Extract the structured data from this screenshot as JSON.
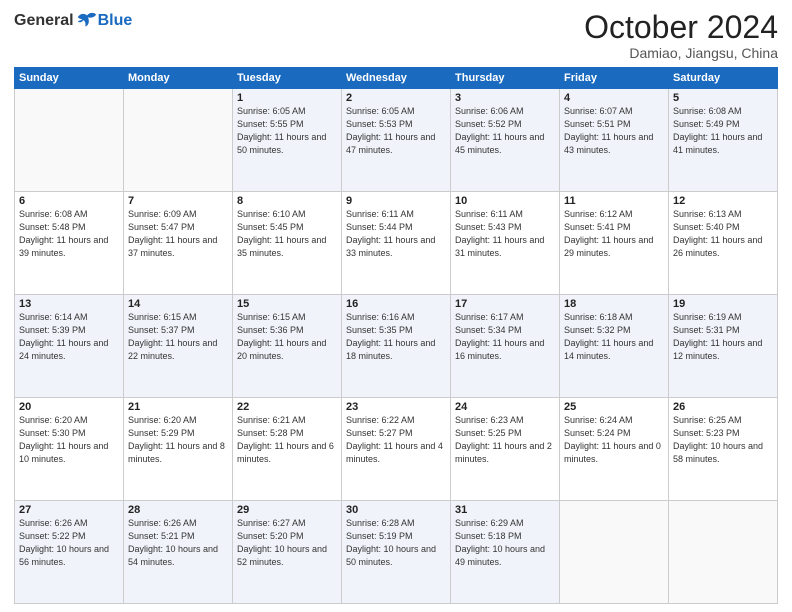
{
  "header": {
    "logo_general": "General",
    "logo_blue": "Blue",
    "month": "October 2024",
    "location": "Damiao, Jiangsu, China"
  },
  "weekdays": [
    "Sunday",
    "Monday",
    "Tuesday",
    "Wednesday",
    "Thursday",
    "Friday",
    "Saturday"
  ],
  "weeks": [
    [
      {
        "day": "",
        "info": ""
      },
      {
        "day": "",
        "info": ""
      },
      {
        "day": "1",
        "info": "Sunrise: 6:05 AM\nSunset: 5:55 PM\nDaylight: 11 hours and 50 minutes."
      },
      {
        "day": "2",
        "info": "Sunrise: 6:05 AM\nSunset: 5:53 PM\nDaylight: 11 hours and 47 minutes."
      },
      {
        "day": "3",
        "info": "Sunrise: 6:06 AM\nSunset: 5:52 PM\nDaylight: 11 hours and 45 minutes."
      },
      {
        "day": "4",
        "info": "Sunrise: 6:07 AM\nSunset: 5:51 PM\nDaylight: 11 hours and 43 minutes."
      },
      {
        "day": "5",
        "info": "Sunrise: 6:08 AM\nSunset: 5:49 PM\nDaylight: 11 hours and 41 minutes."
      }
    ],
    [
      {
        "day": "6",
        "info": "Sunrise: 6:08 AM\nSunset: 5:48 PM\nDaylight: 11 hours and 39 minutes."
      },
      {
        "day": "7",
        "info": "Sunrise: 6:09 AM\nSunset: 5:47 PM\nDaylight: 11 hours and 37 minutes."
      },
      {
        "day": "8",
        "info": "Sunrise: 6:10 AM\nSunset: 5:45 PM\nDaylight: 11 hours and 35 minutes."
      },
      {
        "day": "9",
        "info": "Sunrise: 6:11 AM\nSunset: 5:44 PM\nDaylight: 11 hours and 33 minutes."
      },
      {
        "day": "10",
        "info": "Sunrise: 6:11 AM\nSunset: 5:43 PM\nDaylight: 11 hours and 31 minutes."
      },
      {
        "day": "11",
        "info": "Sunrise: 6:12 AM\nSunset: 5:41 PM\nDaylight: 11 hours and 29 minutes."
      },
      {
        "day": "12",
        "info": "Sunrise: 6:13 AM\nSunset: 5:40 PM\nDaylight: 11 hours and 26 minutes."
      }
    ],
    [
      {
        "day": "13",
        "info": "Sunrise: 6:14 AM\nSunset: 5:39 PM\nDaylight: 11 hours and 24 minutes."
      },
      {
        "day": "14",
        "info": "Sunrise: 6:15 AM\nSunset: 5:37 PM\nDaylight: 11 hours and 22 minutes."
      },
      {
        "day": "15",
        "info": "Sunrise: 6:15 AM\nSunset: 5:36 PM\nDaylight: 11 hours and 20 minutes."
      },
      {
        "day": "16",
        "info": "Sunrise: 6:16 AM\nSunset: 5:35 PM\nDaylight: 11 hours and 18 minutes."
      },
      {
        "day": "17",
        "info": "Sunrise: 6:17 AM\nSunset: 5:34 PM\nDaylight: 11 hours and 16 minutes."
      },
      {
        "day": "18",
        "info": "Sunrise: 6:18 AM\nSunset: 5:32 PM\nDaylight: 11 hours and 14 minutes."
      },
      {
        "day": "19",
        "info": "Sunrise: 6:19 AM\nSunset: 5:31 PM\nDaylight: 11 hours and 12 minutes."
      }
    ],
    [
      {
        "day": "20",
        "info": "Sunrise: 6:20 AM\nSunset: 5:30 PM\nDaylight: 11 hours and 10 minutes."
      },
      {
        "day": "21",
        "info": "Sunrise: 6:20 AM\nSunset: 5:29 PM\nDaylight: 11 hours and 8 minutes."
      },
      {
        "day": "22",
        "info": "Sunrise: 6:21 AM\nSunset: 5:28 PM\nDaylight: 11 hours and 6 minutes."
      },
      {
        "day": "23",
        "info": "Sunrise: 6:22 AM\nSunset: 5:27 PM\nDaylight: 11 hours and 4 minutes."
      },
      {
        "day": "24",
        "info": "Sunrise: 6:23 AM\nSunset: 5:25 PM\nDaylight: 11 hours and 2 minutes."
      },
      {
        "day": "25",
        "info": "Sunrise: 6:24 AM\nSunset: 5:24 PM\nDaylight: 11 hours and 0 minutes."
      },
      {
        "day": "26",
        "info": "Sunrise: 6:25 AM\nSunset: 5:23 PM\nDaylight: 10 hours and 58 minutes."
      }
    ],
    [
      {
        "day": "27",
        "info": "Sunrise: 6:26 AM\nSunset: 5:22 PM\nDaylight: 10 hours and 56 minutes."
      },
      {
        "day": "28",
        "info": "Sunrise: 6:26 AM\nSunset: 5:21 PM\nDaylight: 10 hours and 54 minutes."
      },
      {
        "day": "29",
        "info": "Sunrise: 6:27 AM\nSunset: 5:20 PM\nDaylight: 10 hours and 52 minutes."
      },
      {
        "day": "30",
        "info": "Sunrise: 6:28 AM\nSunset: 5:19 PM\nDaylight: 10 hours and 50 minutes."
      },
      {
        "day": "31",
        "info": "Sunrise: 6:29 AM\nSunset: 5:18 PM\nDaylight: 10 hours and 49 minutes."
      },
      {
        "day": "",
        "info": ""
      },
      {
        "day": "",
        "info": ""
      }
    ]
  ]
}
